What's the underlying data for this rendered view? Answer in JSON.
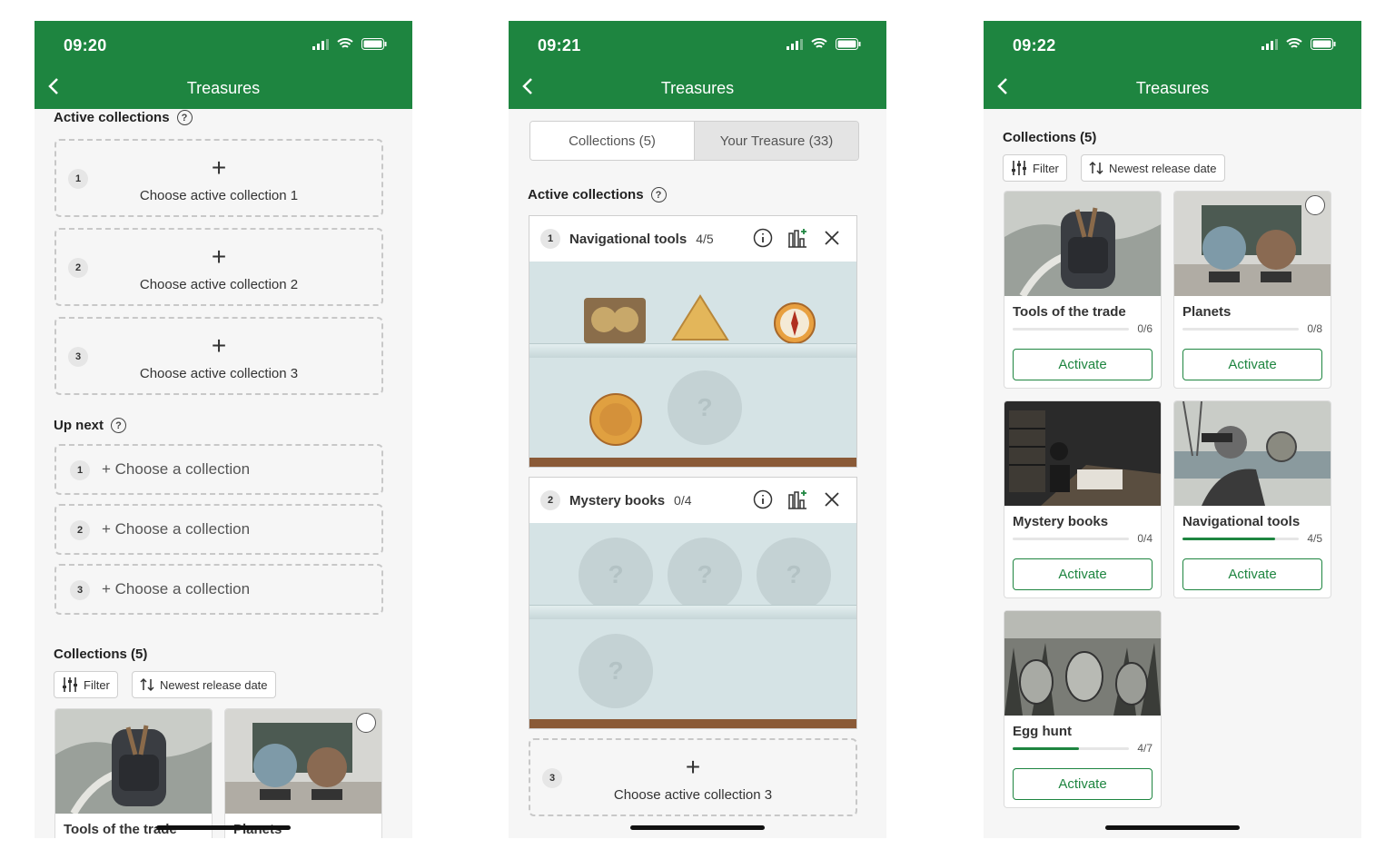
{
  "colors": {
    "brand": "#1e8540",
    "background": "#f6f6f6"
  },
  "screen1": {
    "time": "09:20",
    "title": "Treasures",
    "active_collections_title": "Active collections",
    "active_slots": [
      {
        "num": "1",
        "label": "Choose active collection 1"
      },
      {
        "num": "2",
        "label": "Choose active collection 2"
      },
      {
        "num": "3",
        "label": "Choose active collection 3"
      }
    ],
    "up_next_title": "Up next",
    "up_next_slots": [
      {
        "num": "1",
        "label": "+ Choose a collection"
      },
      {
        "num": "2",
        "label": "+ Choose a collection"
      },
      {
        "num": "3",
        "label": "+ Choose a collection"
      }
    ],
    "collections_title": "Collections (5)",
    "filter_label": "Filter",
    "sort_label": "Newest release date",
    "cards": [
      {
        "title": "Tools of the trade"
      },
      {
        "title": "Planets"
      }
    ]
  },
  "screen2": {
    "time": "09:21",
    "title": "Treasures",
    "tabs": [
      "Collections (5)",
      "Your Treasure (33)"
    ],
    "active_collections_title": "Active collections",
    "shelves": [
      {
        "num": "1",
        "name": "Navigational tools",
        "count": "4/5"
      },
      {
        "num": "2",
        "name": "Mystery books",
        "count": "0/4"
      }
    ],
    "empty_slot": {
      "num": "3",
      "label": "Choose active collection 3"
    },
    "unknown_mark": "?"
  },
  "screen3": {
    "time": "09:22",
    "title": "Treasures",
    "collections_title": "Collections (5)",
    "filter_label": "Filter",
    "sort_label": "Newest release date",
    "cards": [
      {
        "title": "Tools of the trade",
        "count": "0/6",
        "progress": 0,
        "button": "Activate"
      },
      {
        "title": "Planets",
        "count": "0/8",
        "progress": 0,
        "button": "Activate"
      },
      {
        "title": "Mystery books",
        "count": "0/4",
        "progress": 0,
        "button": "Activate"
      },
      {
        "title": "Navigational tools",
        "count": "4/5",
        "progress": 0.8,
        "button": "Activate"
      },
      {
        "title": "Egg hunt",
        "count": "4/7",
        "progress": 0.57,
        "button": "Activate"
      }
    ]
  }
}
